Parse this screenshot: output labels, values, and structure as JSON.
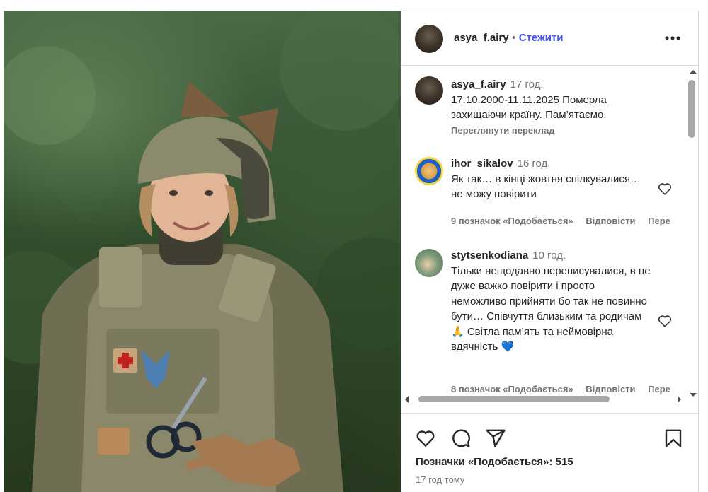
{
  "post": {
    "author": "asya_f.airy",
    "follow_label": "Стежити",
    "separator": "•",
    "more_label": "•••"
  },
  "caption": {
    "username": "asya_f.airy",
    "time": "17 год.",
    "text": "17.10.2000-11.11.2025 Померла захищаючи країну. Пам’ятаємо.",
    "translate_label": "Переглянути переклад"
  },
  "comments": [
    {
      "username": "ihor_sikalov",
      "time": "16 год.",
      "text": "Як так… в кінці жовтня спілкувалися… не можу повірити",
      "likes_label": "9 позначок «Подобається»",
      "reply_label": "Відповісти",
      "more_label": "Пере"
    },
    {
      "username": "stytsenkodiana",
      "time": "10 год.",
      "text": "Тільки нещодавно переписувалися, в це дуже важко повірити і просто неможливо прийняти бо так не повинно бути… Співчуття близьким та родичам 🙏 Світла пам’ять та неймовірна вдячність 💙",
      "likes_label": "8 позначок «Подобається»",
      "reply_label": "Відповісти",
      "more_label": "Пере"
    }
  ],
  "footer": {
    "likes": "Позначки «Подобається»: 515",
    "posted": "17 год тому"
  },
  "icons": {
    "like": "heart-icon",
    "comment": "comment-icon",
    "share": "share-icon",
    "save": "bookmark-icon"
  },
  "colors": {
    "accent": "#4150f7",
    "text": "#262626",
    "secondary": "#737373",
    "border": "#dbdbdb"
  }
}
